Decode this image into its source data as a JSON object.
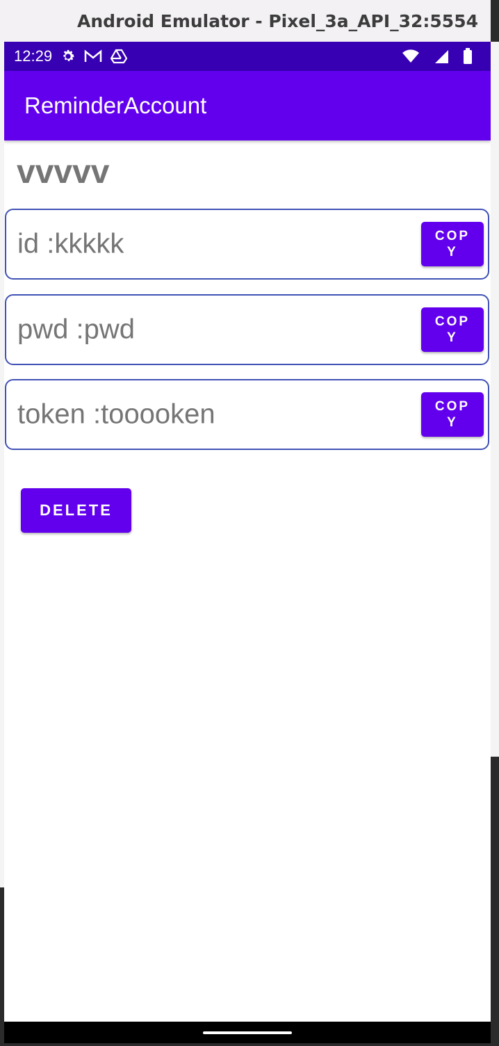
{
  "window": {
    "title": "Android Emulator - Pixel_3a_API_32:5554"
  },
  "status_bar": {
    "time": "12:29",
    "left_icons": [
      "gear-icon",
      "gmail-icon",
      "drive-icon"
    ],
    "right_icons": [
      "wifi-icon",
      "signal-icon",
      "battery-icon"
    ]
  },
  "app_bar": {
    "title": "ReminderAccount"
  },
  "account": {
    "name": "vvvvv",
    "fields": [
      {
        "text": "id :kkkkk",
        "copy_label": "COPY"
      },
      {
        "text": "pwd :pwd",
        "copy_label": "COPY"
      },
      {
        "text": "token :tooooken",
        "copy_label": "COPY"
      }
    ],
    "delete_label": "DELETE"
  },
  "colors": {
    "status_bar": "#3700b3",
    "primary": "#6200ee",
    "field_border": "#3f51b5",
    "text_gray": "#757575"
  }
}
